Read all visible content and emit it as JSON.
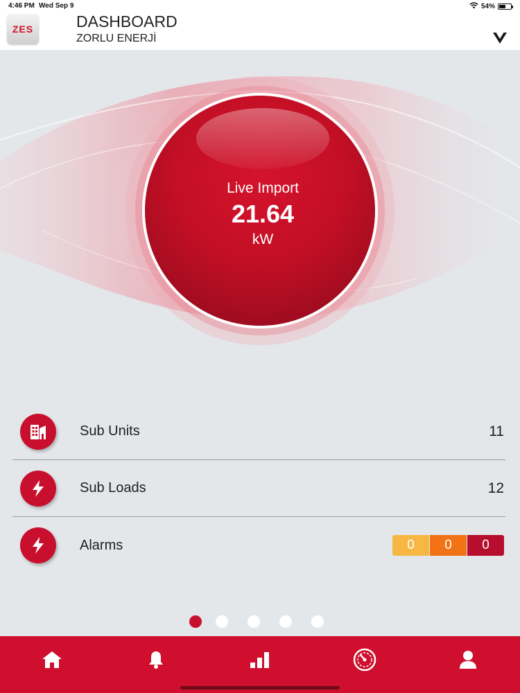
{
  "status_bar": {
    "time": "4:46 PM",
    "date": "Wed Sep 9",
    "battery": "54%",
    "battery_level": 0.54,
    "icons": [
      "wifi-icon",
      "battery-icon"
    ]
  },
  "header": {
    "logo_text": "ZES",
    "title": "DASHBOARD",
    "subtitle": "ZORLU ENERJİ",
    "dropdown_icon": "chevron-down-icon"
  },
  "gauge": {
    "label": "Live Import",
    "value": "21.64",
    "unit": "kW"
  },
  "list": {
    "items": [
      {
        "label": "Sub Units",
        "count": "11",
        "icon": "building-icon"
      },
      {
        "label": "Sub Loads",
        "count": "12",
        "icon": "lightning-icon"
      },
      {
        "label": "Alarms",
        "icon": "lightning-icon",
        "badges": [
          "0",
          "0",
          "0"
        ]
      }
    ]
  },
  "pagination": {
    "total": 5,
    "active": 1
  },
  "tabbar": {
    "tabs": [
      {
        "name": "home",
        "icon": "home-icon",
        "active": true
      },
      {
        "name": "alarms",
        "icon": "bell-icon"
      },
      {
        "name": "reports",
        "icon": "bar-chart-icon"
      },
      {
        "name": "meter",
        "icon": "gauge-icon"
      },
      {
        "name": "profile",
        "icon": "user-icon"
      }
    ]
  },
  "colors": {
    "brand_red": "#cf0f2d",
    "gauge_red": "#c30f25",
    "alarm_low": "#f6b843",
    "alarm_medium": "#f27316",
    "alarm_high": "#b80e2e",
    "background": "#e4e7ea"
  }
}
